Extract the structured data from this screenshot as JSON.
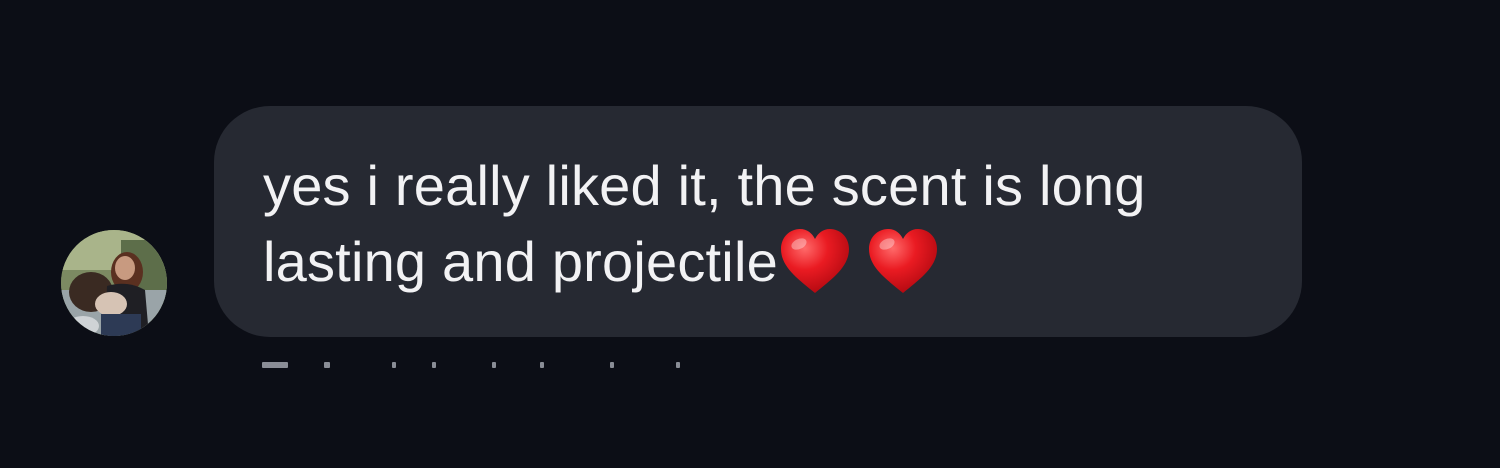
{
  "conversation": {
    "message": {
      "text": "yes i really liked it, the scent is long\nlasting and projectile",
      "emojis": [
        "red-heart",
        "red-heart"
      ]
    }
  },
  "colors": {
    "background": "#0c0e16",
    "bubble": "#262932",
    "text": "#f2f2f4",
    "heart": "#e8141c"
  }
}
